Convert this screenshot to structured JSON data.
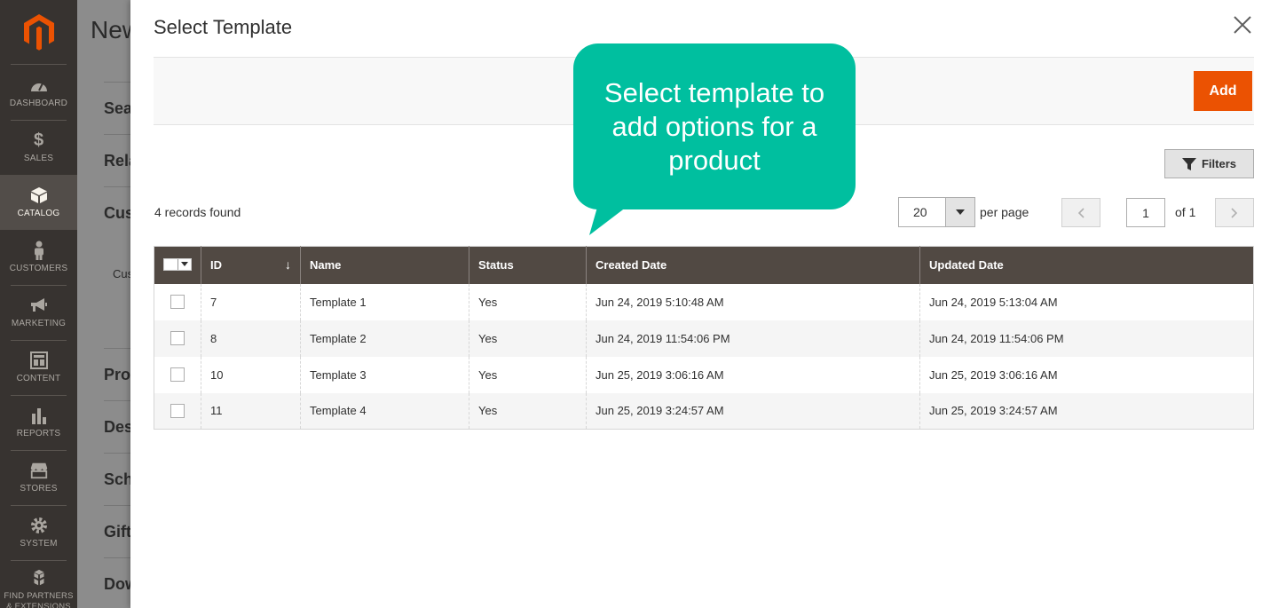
{
  "sidebar": {
    "items": [
      {
        "label": "DASHBOARD",
        "icon": "dashboard-icon"
      },
      {
        "label": "SALES",
        "icon": "dollar-icon"
      },
      {
        "label": "CATALOG",
        "icon": "box-icon",
        "active": true
      },
      {
        "label": "CUSTOMERS",
        "icon": "person-icon"
      },
      {
        "label": "MARKETING",
        "icon": "megaphone-icon"
      },
      {
        "label": "CONTENT",
        "icon": "layout-icon"
      },
      {
        "label": "REPORTS",
        "icon": "bar-chart-icon"
      },
      {
        "label": "STORES",
        "icon": "store-icon"
      },
      {
        "label": "SYSTEM",
        "icon": "gear-icon"
      },
      {
        "label": "FIND PARTNERS & EXTENSIONS",
        "icon": "cubes-icon"
      }
    ]
  },
  "background_page": {
    "title": "New",
    "sections": [
      "Sea",
      "Rela",
      "Cus",
      "Pro",
      "Des",
      "Sch",
      "Gift",
      "Dow"
    ],
    "sub": "Cus"
  },
  "modal": {
    "title": "Select Template",
    "add_label": "Add",
    "filters_label": "Filters",
    "records_found": "4 records found",
    "per_page_value": "20",
    "per_page_label": "per page",
    "page_current": "1",
    "page_of": "of 1",
    "columns": [
      "ID",
      "Name",
      "Status",
      "Created Date",
      "Updated Date"
    ],
    "rows": [
      {
        "id": "7",
        "name": "Template 1",
        "status": "Yes",
        "created": "Jun 24, 2019 5:10:48 AM",
        "updated": "Jun 24, 2019 5:13:04 AM"
      },
      {
        "id": "8",
        "name": "Template 2",
        "status": "Yes",
        "created": "Jun 24, 2019 11:54:06 PM",
        "updated": "Jun 24, 2019 11:54:06 PM"
      },
      {
        "id": "10",
        "name": "Template 3",
        "status": "Yes",
        "created": "Jun 25, 2019 3:06:16 AM",
        "updated": "Jun 25, 2019 3:06:16 AM"
      },
      {
        "id": "11",
        "name": "Template 4",
        "status": "Yes",
        "created": "Jun 25, 2019 3:24:57 AM",
        "updated": "Jun 25, 2019 3:24:57 AM"
      }
    ]
  },
  "tooltip": {
    "text": "Select template to add options for a product"
  },
  "colors": {
    "accent": "#eb5202",
    "sidebar": "#373330",
    "grid_header": "#514943",
    "tooltip": "#00bf9f"
  }
}
